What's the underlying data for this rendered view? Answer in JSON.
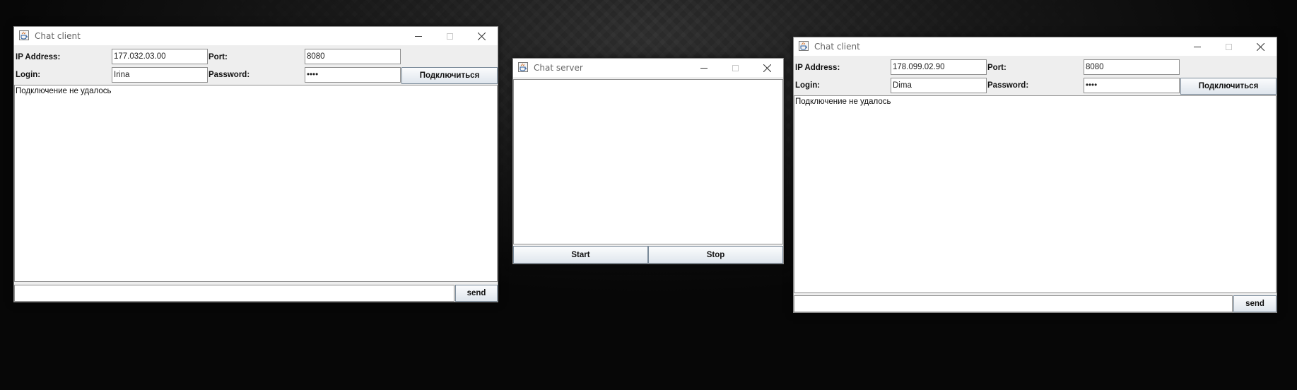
{
  "desktop": {
    "background": "#101010"
  },
  "client_left": {
    "title": "Chat client",
    "ip_label": "IP Address:",
    "ip_value": "177.032.03.00",
    "port_label": "Port:",
    "port_value": "8080",
    "login_label": "Login:",
    "login_value": "Irina",
    "password_label": "Password:",
    "password_value": "••••",
    "connect_label": "Подключиться",
    "log_text": "Подключение не удалось",
    "message_value": "",
    "send_label": "send"
  },
  "server": {
    "title": "Chat server",
    "log_text": "",
    "start_label": "Start",
    "stop_label": "Stop"
  },
  "client_right": {
    "title": "Chat client",
    "ip_label": "IP Address:",
    "ip_value": "178.099.02.90",
    "port_label": "Port:",
    "port_value": "8080",
    "login_label": "Login:",
    "login_value": "Dima",
    "password_label": "Password:",
    "password_value": "••••",
    "connect_label": "Подключиться",
    "log_text": "Подключение не удалось",
    "message_value": "",
    "send_label": "send"
  },
  "icons": [
    "java-icon",
    "minimize-icon",
    "maximize-icon",
    "close-icon"
  ],
  "colors": {
    "button_gradient_top": "#fbfcfd",
    "button_gradient_bottom": "#dfe6ed",
    "window_bg": "#eeeeee"
  }
}
